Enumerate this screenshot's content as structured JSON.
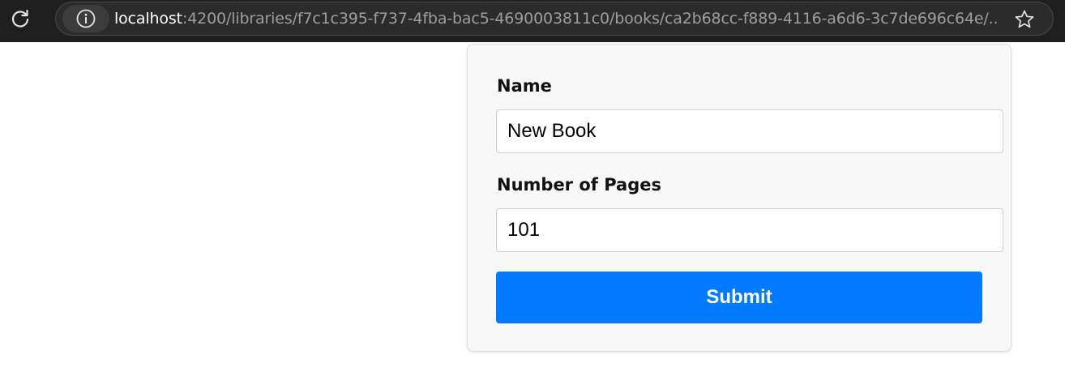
{
  "browser": {
    "url_host": "localhost",
    "url_path": ":4200/libraries/f7c1c395-f737-4fba-bac5-4690003811c0/books/ca2b68cc-f889-4116-a6d6-3c7de696c64e/...",
    "icons": {
      "reload": "reload-icon",
      "site_info": "info-icon",
      "bookmark": "star-icon"
    }
  },
  "form": {
    "name_label": "Name",
    "name_value": "New Book",
    "pages_label": "Number of Pages",
    "pages_value": "101",
    "submit_label": "Submit"
  },
  "colors": {
    "submit_button": "#007bff",
    "card_background": "#f8f8f8",
    "toolbar_background": "#1f1f1f"
  }
}
